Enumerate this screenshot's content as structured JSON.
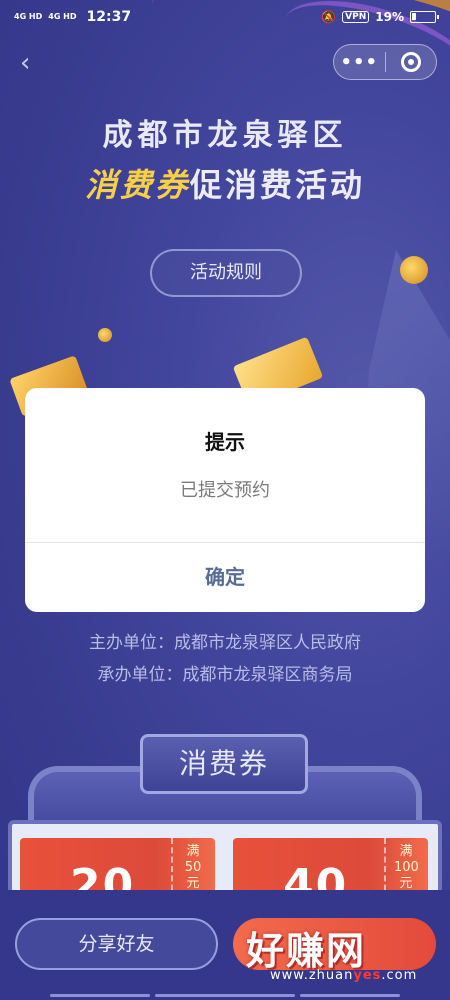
{
  "status_bar": {
    "signal_1": "4G HD",
    "signal_2": "4G HD",
    "time": "12:37",
    "vpn": "VPN",
    "battery_percent_text": "19%",
    "battery_level": 0.19
  },
  "nav": {
    "back_icon": "chevron-left-icon",
    "more_icon": "more-dots-icon",
    "close_icon": "target-close-icon"
  },
  "header": {
    "title_line1": "成都市龙泉驿区",
    "title_line2_highlight": "消费券",
    "title_line2_rest": "促消费活动"
  },
  "rules_button": {
    "label": "活动规则"
  },
  "dialog": {
    "title": "提示",
    "message": "已提交预约",
    "confirm_label": "确定"
  },
  "organizers": {
    "host": "主办单位：成都市龙泉驿区人民政府",
    "organizer": "承办单位：成都市龙泉驿区商务局"
  },
  "voucher_section": {
    "tab_label": "消费券",
    "cards": [
      {
        "amount": "20",
        "condition": "满50元"
      },
      {
        "amount": "40",
        "condition": "满100元"
      }
    ]
  },
  "bottom": {
    "share_label": "分享好友"
  },
  "watermark": {
    "text": "好赚网",
    "url_prefix": "www.zhuan",
    "url_highlight": "yes",
    "url_suffix": ".com"
  },
  "colors": {
    "background": "#3b3e92",
    "highlight_yellow": "#f7d047",
    "dialog_button": "#576b95",
    "voucher_red": "#e8513b"
  }
}
